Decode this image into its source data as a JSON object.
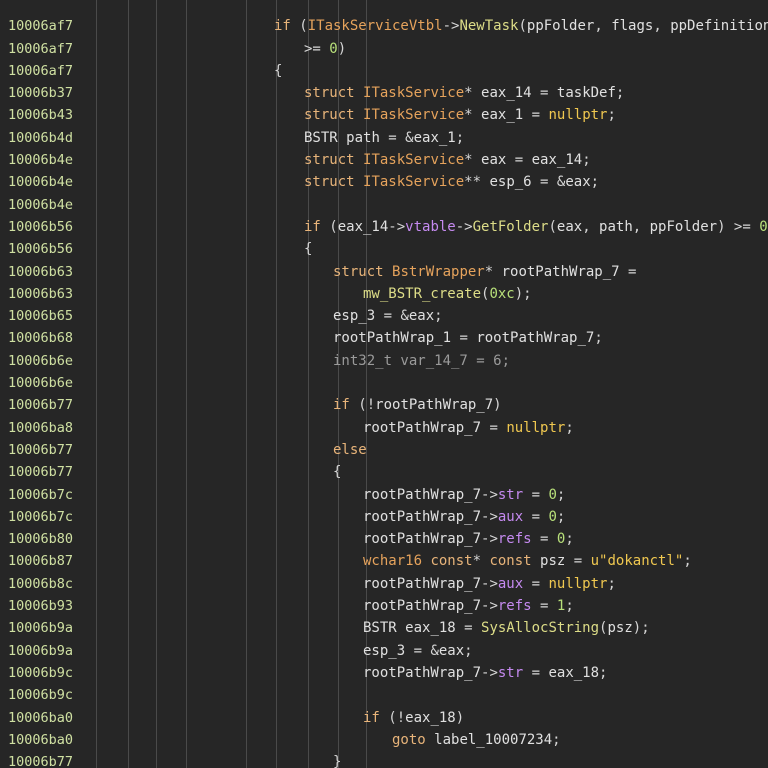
{
  "guide_columns": [
    96,
    128,
    156,
    186,
    246,
    276,
    308,
    338,
    366
  ],
  "lines": [
    {
      "addr": "",
      "indent": 0,
      "tokens": []
    },
    {
      "addr": "10006af7",
      "indent": 274,
      "tokens": [
        [
          "kw",
          "if"
        ],
        [
          "punct",
          " ("
        ],
        [
          "type",
          "ITaskServiceVtbl"
        ],
        [
          "punct",
          "->"
        ],
        [
          "func",
          "NewTask"
        ],
        [
          "punct",
          "("
        ],
        [
          "plain",
          "ppFolder"
        ],
        [
          "punct",
          ", "
        ],
        [
          "plain",
          "flags"
        ],
        [
          "punct",
          ", "
        ],
        [
          "plain",
          "ppDefinition"
        ],
        [
          "punct",
          ")"
        ]
      ]
    },
    {
      "addr": "10006af7",
      "indent": 304,
      "tokens": [
        [
          "punct",
          ">= "
        ],
        [
          "num",
          "0"
        ],
        [
          "punct",
          ")"
        ]
      ]
    },
    {
      "addr": "10006af7",
      "indent": 274,
      "tokens": [
        [
          "punct",
          "{"
        ]
      ]
    },
    {
      "addr": "10006b37",
      "indent": 304,
      "tokens": [
        [
          "kw",
          "struct "
        ],
        [
          "type",
          "ITaskService"
        ],
        [
          "punct",
          "* "
        ],
        [
          "plain",
          "eax_14"
        ],
        [
          "punct",
          " = "
        ],
        [
          "plain",
          "taskDef"
        ],
        [
          "punct",
          ";"
        ]
      ]
    },
    {
      "addr": "10006b43",
      "indent": 304,
      "tokens": [
        [
          "kw",
          "struct "
        ],
        [
          "type",
          "ITaskService"
        ],
        [
          "punct",
          "* "
        ],
        [
          "plain",
          "eax_1"
        ],
        [
          "punct",
          " = "
        ],
        [
          "null",
          "nullptr"
        ],
        [
          "punct",
          ";"
        ]
      ]
    },
    {
      "addr": "10006b4d",
      "indent": 304,
      "tokens": [
        [
          "plain",
          "BSTR "
        ],
        [
          "plain",
          "path"
        ],
        [
          "punct",
          " = &"
        ],
        [
          "plain",
          "eax_1"
        ],
        [
          "punct",
          ";"
        ]
      ]
    },
    {
      "addr": "10006b4e",
      "indent": 304,
      "tokens": [
        [
          "kw",
          "struct "
        ],
        [
          "type",
          "ITaskService"
        ],
        [
          "punct",
          "* "
        ],
        [
          "plain",
          "eax"
        ],
        [
          "punct",
          " = "
        ],
        [
          "plain",
          "eax_14"
        ],
        [
          "punct",
          ";"
        ]
      ]
    },
    {
      "addr": "10006b4e",
      "indent": 304,
      "tokens": [
        [
          "kw",
          "struct "
        ],
        [
          "type",
          "ITaskService"
        ],
        [
          "punct",
          "** "
        ],
        [
          "plain",
          "esp_6"
        ],
        [
          "punct",
          " = &"
        ],
        [
          "plain",
          "eax"
        ],
        [
          "punct",
          ";"
        ]
      ]
    },
    {
      "addr": "10006b4e",
      "indent": 304,
      "tokens": []
    },
    {
      "addr": "10006b56",
      "indent": 304,
      "tokens": [
        [
          "kw",
          "if"
        ],
        [
          "punct",
          " ("
        ],
        [
          "plain",
          "eax_14"
        ],
        [
          "punct",
          "->"
        ],
        [
          "member",
          "vtable"
        ],
        [
          "punct",
          "->"
        ],
        [
          "func",
          "GetFolder"
        ],
        [
          "punct",
          "("
        ],
        [
          "plain",
          "eax"
        ],
        [
          "punct",
          ", "
        ],
        [
          "plain",
          "path"
        ],
        [
          "punct",
          ", "
        ],
        [
          "plain",
          "ppFolder"
        ],
        [
          "punct",
          ") >= "
        ],
        [
          "num",
          "0"
        ],
        [
          "punct",
          ")"
        ]
      ]
    },
    {
      "addr": "10006b56",
      "indent": 304,
      "tokens": [
        [
          "punct",
          "{"
        ]
      ]
    },
    {
      "addr": "10006b63",
      "indent": 333,
      "tokens": [
        [
          "kw",
          "struct "
        ],
        [
          "type",
          "BstrWrapper"
        ],
        [
          "punct",
          "* "
        ],
        [
          "plain",
          "rootPathWrap_7"
        ],
        [
          "punct",
          " ="
        ]
      ]
    },
    {
      "addr": "10006b63",
      "indent": 363,
      "tokens": [
        [
          "func",
          "mw_BSTR_create"
        ],
        [
          "punct",
          "("
        ],
        [
          "num",
          "0xc"
        ],
        [
          "punct",
          ");"
        ]
      ]
    },
    {
      "addr": "10006b65",
      "indent": 333,
      "tokens": [
        [
          "plain",
          "esp_3"
        ],
        [
          "punct",
          " = &"
        ],
        [
          "plain",
          "eax"
        ],
        [
          "punct",
          ";"
        ]
      ]
    },
    {
      "addr": "10006b68",
      "indent": 333,
      "tokens": [
        [
          "plain",
          "rootPathWrap_1"
        ],
        [
          "punct",
          " = "
        ],
        [
          "plain",
          "rootPathWrap_7"
        ],
        [
          "punct",
          ";"
        ]
      ]
    },
    {
      "addr": "10006b6e",
      "indent": 333,
      "tokens": [
        [
          "dim",
          "int32_t var_14_7 = 6;"
        ]
      ]
    },
    {
      "addr": "10006b6e",
      "indent": 333,
      "tokens": []
    },
    {
      "addr": "10006b77",
      "indent": 333,
      "tokens": [
        [
          "kw",
          "if"
        ],
        [
          "punct",
          " (!"
        ],
        [
          "plain",
          "rootPathWrap_7"
        ],
        [
          "punct",
          ")"
        ]
      ]
    },
    {
      "addr": "10006ba8",
      "indent": 363,
      "tokens": [
        [
          "plain",
          "rootPathWrap_7"
        ],
        [
          "punct",
          " = "
        ],
        [
          "null",
          "nullptr"
        ],
        [
          "punct",
          ";"
        ]
      ]
    },
    {
      "addr": "10006b77",
      "indent": 333,
      "tokens": [
        [
          "kw",
          "else"
        ]
      ]
    },
    {
      "addr": "10006b77",
      "indent": 333,
      "tokens": [
        [
          "punct",
          "{"
        ]
      ]
    },
    {
      "addr": "10006b7c",
      "indent": 363,
      "tokens": [
        [
          "plain",
          "rootPathWrap_7"
        ],
        [
          "punct",
          "->"
        ],
        [
          "member",
          "str"
        ],
        [
          "punct",
          " = "
        ],
        [
          "num",
          "0"
        ],
        [
          "punct",
          ";"
        ]
      ]
    },
    {
      "addr": "10006b7c",
      "indent": 363,
      "tokens": [
        [
          "plain",
          "rootPathWrap_7"
        ],
        [
          "punct",
          "->"
        ],
        [
          "member",
          "aux"
        ],
        [
          "punct",
          " = "
        ],
        [
          "num",
          "0"
        ],
        [
          "punct",
          ";"
        ]
      ]
    },
    {
      "addr": "10006b80",
      "indent": 363,
      "tokens": [
        [
          "plain",
          "rootPathWrap_7"
        ],
        [
          "punct",
          "->"
        ],
        [
          "member",
          "refs"
        ],
        [
          "punct",
          " = "
        ],
        [
          "num",
          "0"
        ],
        [
          "punct",
          ";"
        ]
      ]
    },
    {
      "addr": "10006b87",
      "indent": 363,
      "tokens": [
        [
          "type",
          "wchar16 "
        ],
        [
          "kw",
          "const"
        ],
        [
          "punct",
          "* "
        ],
        [
          "kw",
          "const "
        ],
        [
          "plain",
          "psz"
        ],
        [
          "punct",
          " = "
        ],
        [
          "str",
          "u\"dokanctl\""
        ],
        [
          "punct",
          ";"
        ]
      ]
    },
    {
      "addr": "10006b8c",
      "indent": 363,
      "tokens": [
        [
          "plain",
          "rootPathWrap_7"
        ],
        [
          "punct",
          "->"
        ],
        [
          "member",
          "aux"
        ],
        [
          "punct",
          " = "
        ],
        [
          "null",
          "nullptr"
        ],
        [
          "punct",
          ";"
        ]
      ]
    },
    {
      "addr": "10006b93",
      "indent": 363,
      "tokens": [
        [
          "plain",
          "rootPathWrap_7"
        ],
        [
          "punct",
          "->"
        ],
        [
          "member",
          "refs"
        ],
        [
          "punct",
          " = "
        ],
        [
          "num",
          "1"
        ],
        [
          "punct",
          ";"
        ]
      ]
    },
    {
      "addr": "10006b9a",
      "indent": 363,
      "tokens": [
        [
          "plain",
          "BSTR "
        ],
        [
          "plain",
          "eax_18"
        ],
        [
          "punct",
          " = "
        ],
        [
          "func",
          "SysAllocString"
        ],
        [
          "punct",
          "("
        ],
        [
          "plain",
          "psz"
        ],
        [
          "punct",
          ");"
        ]
      ]
    },
    {
      "addr": "10006b9a",
      "indent": 363,
      "tokens": [
        [
          "plain",
          "esp_3"
        ],
        [
          "punct",
          " = &"
        ],
        [
          "plain",
          "eax"
        ],
        [
          "punct",
          ";"
        ]
      ]
    },
    {
      "addr": "10006b9c",
      "indent": 363,
      "tokens": [
        [
          "plain",
          "rootPathWrap_7"
        ],
        [
          "punct",
          "->"
        ],
        [
          "member",
          "str"
        ],
        [
          "punct",
          " = "
        ],
        [
          "plain",
          "eax_18"
        ],
        [
          "punct",
          ";"
        ]
      ]
    },
    {
      "addr": "10006b9c",
      "indent": 363,
      "tokens": []
    },
    {
      "addr": "10006ba0",
      "indent": 363,
      "tokens": [
        [
          "kw",
          "if"
        ],
        [
          "punct",
          " (!"
        ],
        [
          "plain",
          "eax_18"
        ],
        [
          "punct",
          ")"
        ]
      ]
    },
    {
      "addr": "10006ba0",
      "indent": 392,
      "tokens": [
        [
          "kw",
          "goto "
        ],
        [
          "plain",
          "label_10007234"
        ],
        [
          "punct",
          ";"
        ]
      ]
    },
    {
      "addr": "10006b77",
      "indent": 333,
      "tokens": [
        [
          "punct",
          "}"
        ]
      ]
    },
    {
      "addr": "",
      "indent": 0,
      "tokens": []
    }
  ]
}
